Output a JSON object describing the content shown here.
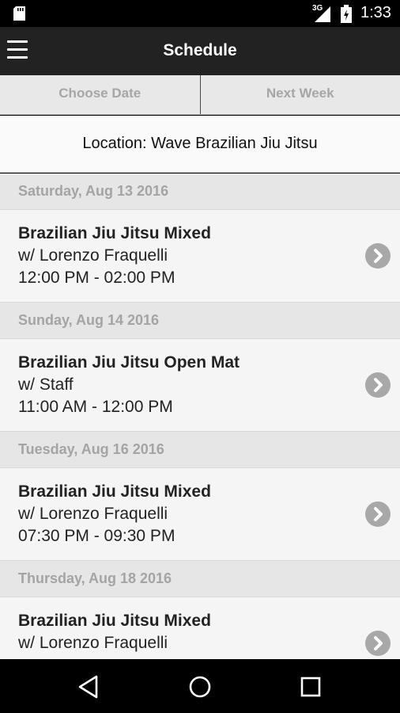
{
  "status_bar": {
    "network": "3G",
    "time": "1:33",
    "icons": [
      "sd-card-icon",
      "signal-icon",
      "battery-icon"
    ]
  },
  "app_bar": {
    "title": "Schedule",
    "menu_icon": "hamburger-menu-icon"
  },
  "tabs": {
    "choose_date": "Choose Date",
    "next_week": "Next Week"
  },
  "location": "Location: Wave Brazilian Jiu Jitsu",
  "days": [
    {
      "date": "Saturday, Aug 13 2016",
      "classes": [
        {
          "name": "Brazilian Jiu Jitsu Mixed",
          "instructor": "w/ Lorenzo Fraquelli",
          "time": "12:00 PM - 02:00 PM"
        }
      ]
    },
    {
      "date": "Sunday, Aug 14 2016",
      "classes": [
        {
          "name": "Brazilian Jiu Jitsu Open Mat",
          "instructor": "w/ Staff",
          "time": "11:00 AM - 12:00 PM"
        }
      ]
    },
    {
      "date": "Tuesday, Aug 16 2016",
      "classes": [
        {
          "name": "Brazilian Jiu Jitsu Mixed",
          "instructor": "w/ Lorenzo Fraquelli",
          "time": "07:30 PM - 09:30 PM"
        }
      ]
    },
    {
      "date": "Thursday, Aug 18 2016",
      "classes": [
        {
          "name": "Brazilian Jiu Jitsu Mixed",
          "instructor": "w/ Lorenzo Fraquelli",
          "time": ""
        }
      ]
    }
  ],
  "nav_bar": {
    "icons": [
      "back-icon",
      "home-icon",
      "recents-icon"
    ]
  }
}
